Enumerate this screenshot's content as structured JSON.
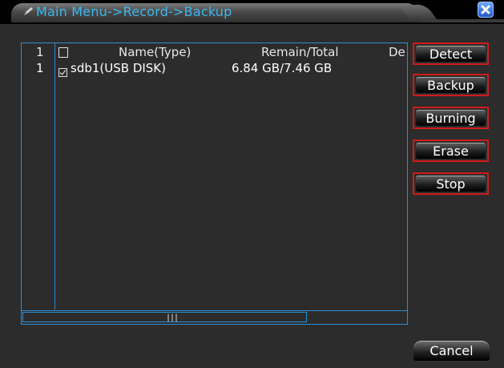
{
  "window": {
    "title": "Main Menu->Record->Backup"
  },
  "table": {
    "headers": {
      "index": "1",
      "name": "Name(Type)",
      "remain_total": "Remain/Total",
      "de": "De"
    },
    "rows": [
      {
        "index": "1",
        "name": "sdb1(USB DISK)",
        "remain_total": "6.84 GB/7.46 GB",
        "checked": true
      }
    ],
    "scrollbar_grip": "|||"
  },
  "buttons": {
    "detect": "Detect",
    "backup": "Backup",
    "burning": "Burning",
    "erase": "Erase",
    "stop": "Stop",
    "cancel": "Cancel"
  },
  "icons": {
    "title": "pencil-icon",
    "close": "close-icon",
    "header_checkbox": "checkbox-icon",
    "row_checkbox": "checkbox-checked-icon"
  },
  "colors": {
    "title_text": "#3cb7ee",
    "table_border": "#2a8fd8",
    "button_highlight": "#d21a1a"
  }
}
